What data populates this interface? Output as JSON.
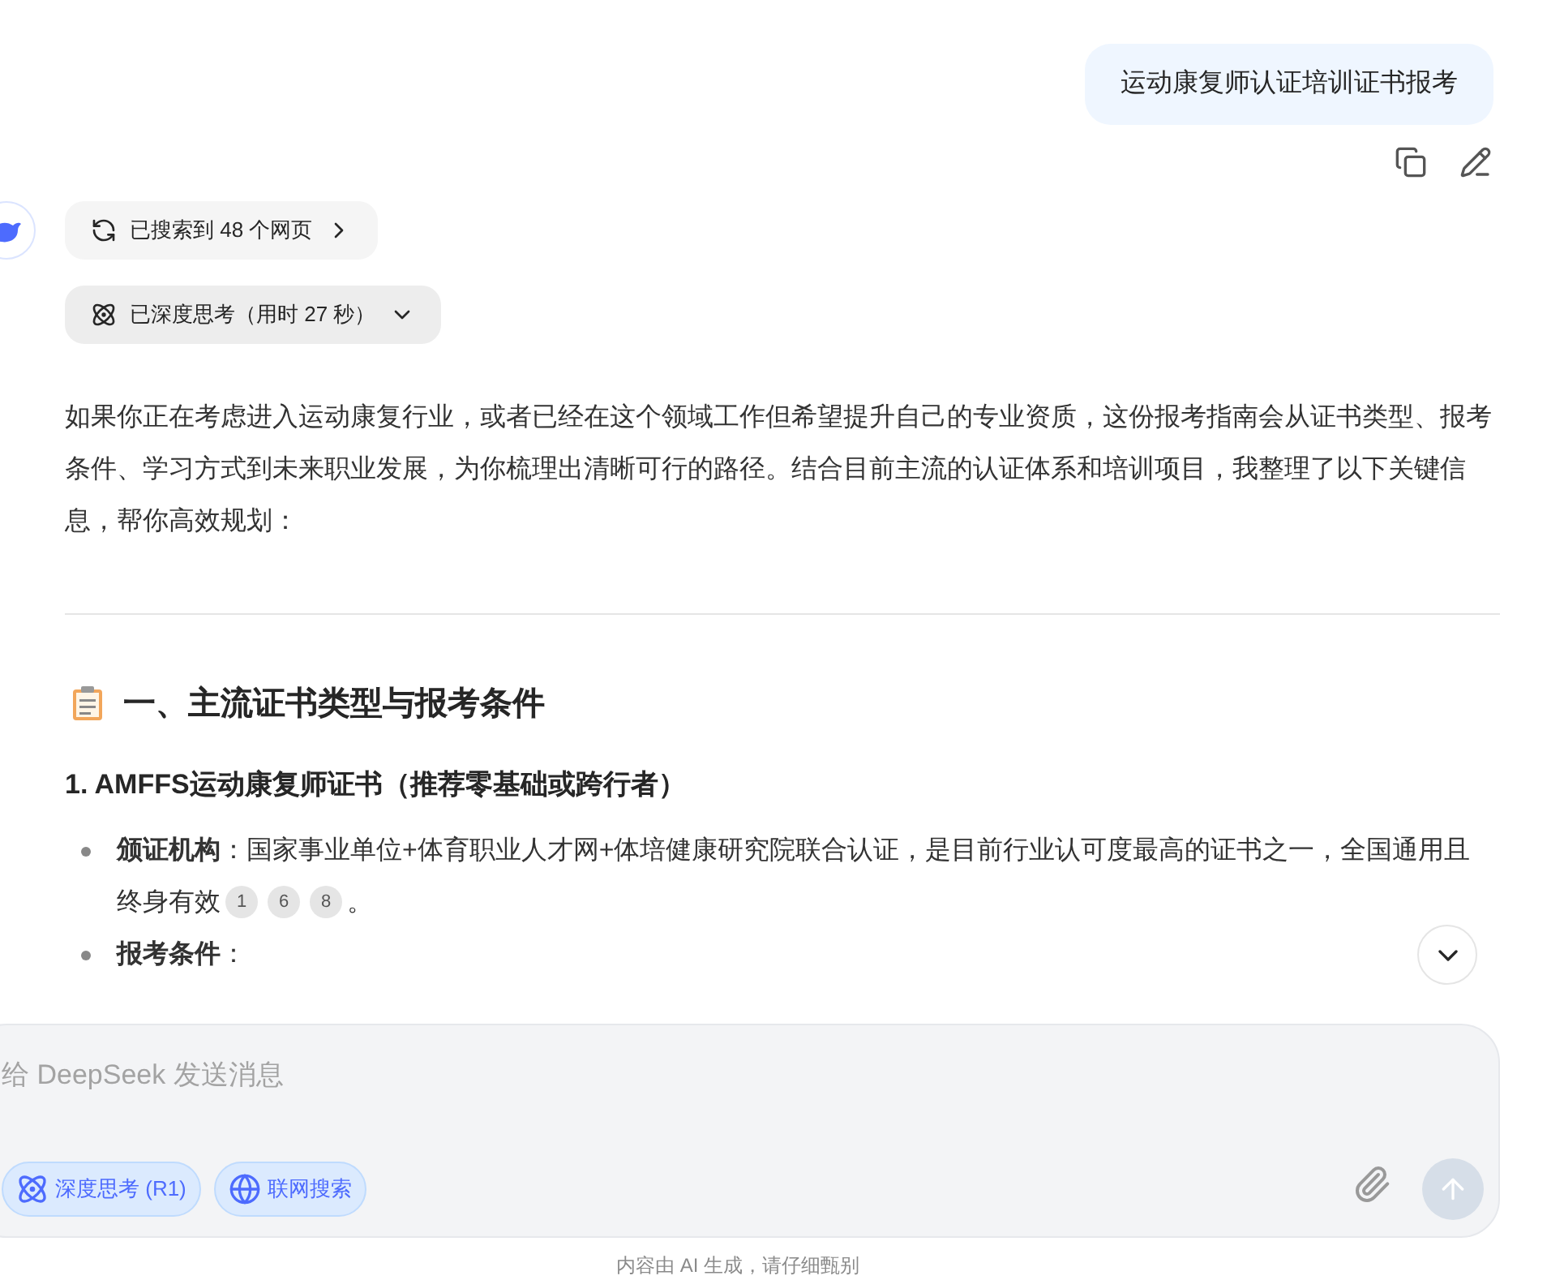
{
  "user_message": {
    "text": "运动康复师认证培训证书报考"
  },
  "search_chip": {
    "label": "已搜索到 48 个网页"
  },
  "think_chip": {
    "label": "已深度思考（用时 27 秒）",
    "expanded": false
  },
  "intro": "如果你正在考虑进入运动康复行业，或者已经在这个领域工作但希望提升自己的专业资质，这份报考指南会从证书类型、报考条件、学习方式到未来职业发展，为你梳理出清晰可行的路径。结合目前主流的认证体系和培训项目，我整理了以下关键信息，帮你高效规划：",
  "section_heading": "一、主流证书类型与报考条件",
  "subheading": "1. AMFFS运动康复师证书（推荐零基础或跨行者）",
  "bullets": [
    {
      "text": "**颁证机构**：国家事业单位+体育职业人才网+体培健康研究院联合认证，是目前行业认可度最高的证书之一，全国通用且终身有效",
      "citations": [
        "1",
        "6",
        "8"
      ],
      "end": "。"
    },
    {
      "text": "**报考条件**："
    }
  ],
  "composer": {
    "placeholder": "给 DeepSeek 发送消息",
    "toggles": [
      {
        "label": "深度思考 (R1)",
        "kind": "think",
        "selected": true
      },
      {
        "label": "联网搜索",
        "kind": "web",
        "selected": true
      }
    ],
    "send_disabled": true
  },
  "footer": "内容由 AI 生成，请仔细甄别"
}
